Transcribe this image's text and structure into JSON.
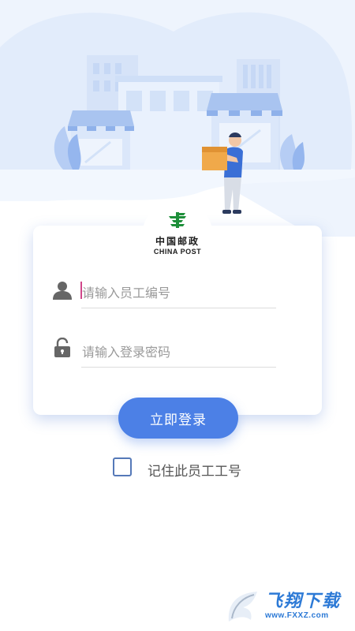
{
  "logo": {
    "name_cn": "中国邮政",
    "name_en": "CHINA POST"
  },
  "form": {
    "employee_id_placeholder": "请输入员工编号",
    "password_placeholder": "请输入登录密码",
    "login_button": "立即登录",
    "remember_label": "记住此员工工号",
    "remember_checked": false
  },
  "watermark": {
    "title": "飞翔下载",
    "url": "www.FXXZ.com"
  },
  "colors": {
    "primary": "#4c80e6",
    "logo_green": "#1e8f3a",
    "illustration_light": "#dde9fb",
    "placeholder": "#9a9a9a"
  },
  "icons": [
    "user-icon",
    "lock-icon",
    "china-post-logo"
  ]
}
